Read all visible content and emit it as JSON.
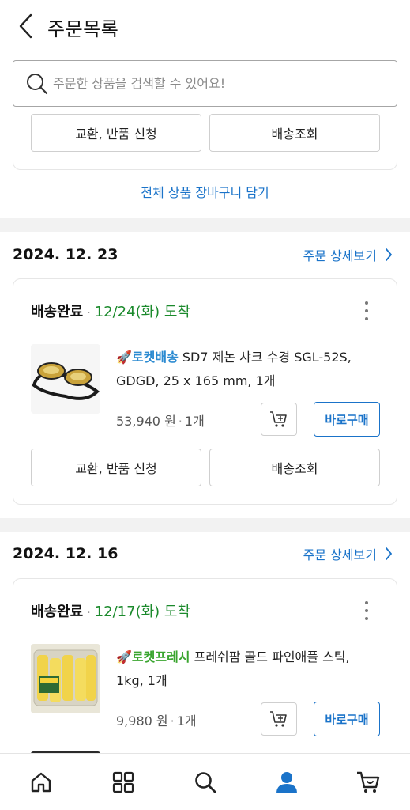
{
  "header": {
    "title": "주문목록",
    "back_icon": "chevron-left-icon"
  },
  "search": {
    "placeholder": "주문한 상품을 검색할 수 있어요!"
  },
  "prev_card": {
    "exchange_label": "교환, 반품 신청",
    "tracking_label": "배송조회"
  },
  "add_all_to_cart": "전체 상품 장바구니 담기",
  "orders": [
    {
      "date": "2024. 12. 23",
      "detail_link": "주문 상세보기",
      "status": "배송완료",
      "arrival": "12/24(화) 도착",
      "product": {
        "badge": "로켓배송",
        "name": " SD7 제논 샤크 수경 SGL-52S, GDGD, 25 x 165 mm, 1개",
        "price": "53,940 원",
        "qty": "1개"
      },
      "buy_label": "바로구매",
      "exchange_label": "교환, 반품 신청",
      "tracking_label": "배송조회"
    },
    {
      "date": "2024. 12. 16",
      "detail_link": "주문 상세보기",
      "status": "배송완료",
      "arrival": "12/17(화) 도착",
      "product": {
        "badge": "로켓프레시",
        "name": " 프레쉬팜 골드 파인애플 스틱, 1kg, 1개",
        "price": "9,980 원",
        "qty": "1개"
      },
      "buy_label": "바로구매"
    }
  ],
  "colors": {
    "accent": "#1a73c9",
    "arrival_green": "#1b8a2c",
    "rocket_blue": "#2c8bd1",
    "rocket_green": "#3aa52f",
    "active_nav": "#1a73c9"
  },
  "bottom_nav": {
    "items": [
      "home-icon",
      "category-grid-icon",
      "search-icon",
      "my-account-icon",
      "cart-icon"
    ],
    "active": "my-account-icon"
  }
}
